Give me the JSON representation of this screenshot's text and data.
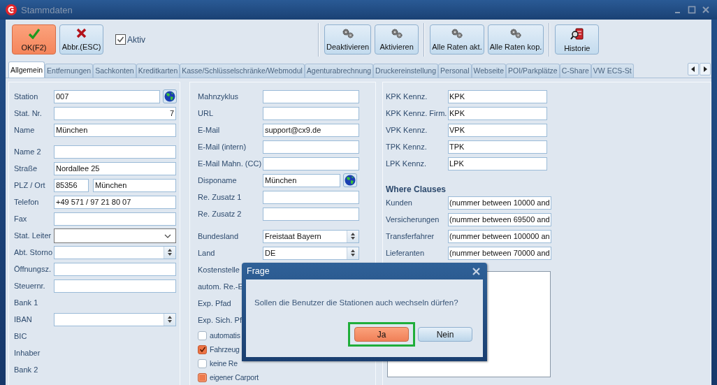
{
  "window": {
    "title": "Stammdaten"
  },
  "toolbar": {
    "groups": [
      [
        {
          "kind": "button",
          "label": "OK(F2)",
          "primary": true
        },
        {
          "kind": "button",
          "label": "Abbr.(ESC)",
          "primary": false
        },
        {
          "kind": "checkbox",
          "label": "Aktiv",
          "checked": true
        }
      ],
      [
        {
          "kind": "button",
          "label": "Deaktivieren",
          "primary": false
        },
        {
          "kind": "button",
          "label": "Aktivieren",
          "primary": false
        }
      ],
      [
        {
          "kind": "button",
          "label": "Alle Raten akt.",
          "primary": false
        },
        {
          "kind": "button",
          "label": "Alle Raten kop.",
          "primary": false
        }
      ],
      [
        {
          "kind": "button",
          "label": "Historie",
          "primary": false
        }
      ]
    ]
  },
  "tabs": [
    {
      "label": "Allgemein",
      "selected": true
    },
    {
      "label": "Entfernungen",
      "selected": false
    },
    {
      "label": "Sachkonten",
      "selected": false
    },
    {
      "label": "Kreditkarten",
      "selected": false
    },
    {
      "label": "Kasse/Schlüsselschränke/Webmodul",
      "selected": false
    },
    {
      "label": "Agenturabrechnung",
      "selected": false
    },
    {
      "label": "Druckereinstellung",
      "selected": false
    },
    {
      "label": "Personal",
      "selected": false
    },
    {
      "label": "Webseite",
      "selected": false
    },
    {
      "label": "POI/Parkplätze",
      "selected": false
    },
    {
      "label": "C-Share",
      "selected": false
    },
    {
      "label": "VW ECS-St",
      "selected": false
    }
  ],
  "left_panel": {
    "sections": [
      [
        {
          "kind": "text",
          "label": "Station",
          "value": "007",
          "globe": true
        },
        {
          "kind": "number",
          "label": "Stat. Nr.",
          "value": "7"
        },
        {
          "kind": "text",
          "label": "Name",
          "value": "München"
        }
      ],
      [
        {
          "kind": "text",
          "label": "Name 2"
        },
        {
          "kind": "text",
          "label": "Straße",
          "value": "Nordallee 25"
        },
        {
          "kind": "pair",
          "label": "PLZ / Ort",
          "values": [
            "85356",
            "München"
          ]
        },
        {
          "kind": "text",
          "label": "Telefon",
          "value": "+49 571 / 97 21 80 07"
        },
        {
          "kind": "text",
          "label": "Fax"
        },
        {
          "kind": "dropdown",
          "label": "Stat. Leiter"
        },
        {
          "kind": "spin",
          "label": "Abt. Storno"
        },
        {
          "kind": "text",
          "label": "Öffnungsz."
        },
        {
          "kind": "text",
          "label": "Steuernr."
        },
        {
          "kind": "label",
          "label": "Bank 1"
        },
        {
          "kind": "spin",
          "label": "IBAN"
        },
        {
          "kind": "label",
          "label": "BIC"
        },
        {
          "kind": "label",
          "label": "Inhaber"
        },
        {
          "kind": "label",
          "label": "Bank 2"
        }
      ]
    ]
  },
  "middle_panel": {
    "sections": [
      [
        {
          "kind": "text",
          "label": "Mahnzyklus"
        },
        {
          "kind": "text",
          "label": "URL"
        },
        {
          "kind": "text",
          "label": "E-Mail",
          "value": "support@cx9.de"
        },
        {
          "kind": "text",
          "label": "E-Mail (intern)"
        },
        {
          "kind": "text",
          "label": "E-Mail Mahn. (CC)"
        },
        {
          "kind": "text",
          "label": "Disponame",
          "value": "München",
          "globe": true
        },
        {
          "kind": "text",
          "label": "Re. Zusatz 1"
        },
        {
          "kind": "text",
          "label": "Re. Zusatz 2"
        }
      ],
      [
        {
          "kind": "spin",
          "label": "Bundesland",
          "value": "Freistaat Bayern"
        },
        {
          "kind": "spin",
          "label": "Land",
          "value": "DE"
        },
        {
          "kind": "label",
          "label": "Kostenstelle"
        },
        {
          "kind": "label",
          "label": "autom. Re.-E"
        },
        {
          "kind": "label",
          "label": "Exp. Pfad"
        },
        {
          "kind": "label",
          "label": "Exp. Sich. Pf"
        },
        {
          "kind": "checkbox",
          "label": "automatis",
          "checked": false,
          "indeterminate": false
        },
        {
          "kind": "checkbox",
          "label": "Fahrzeug",
          "checked": true,
          "indeterminate": false
        },
        {
          "kind": "checkbox",
          "label": "keine Re",
          "checked": false,
          "indeterminate": false
        },
        {
          "kind": "checkbox",
          "label": "eigener Carport",
          "checked": false,
          "indeterminate": true
        }
      ]
    ]
  },
  "right_panel": {
    "sections": [
      [
        {
          "kind": "text",
          "label": "KPK Kennz.",
          "value": "KPK"
        },
        {
          "kind": "text",
          "label": "KPK Kennz. Firm.",
          "value": "KPK"
        },
        {
          "kind": "text",
          "label": "VPK Kennz.",
          "value": "VPK"
        },
        {
          "kind": "text",
          "label": "TPK Kennz.",
          "value": "TPK"
        },
        {
          "kind": "text",
          "label": "LPK Kennz.",
          "value": "LPK"
        }
      ],
      [
        {
          "kind": "heading",
          "label": "Where Clauses"
        },
        {
          "kind": "text",
          "label": "Kunden",
          "value": "(nummer between 10000 and"
        },
        {
          "kind": "text",
          "label": "Versicherungen",
          "value": "(nummer between 69500 and"
        },
        {
          "kind": "text",
          "label": "Transferfahrer",
          "value": "(nummer between 100000 an"
        },
        {
          "kind": "text",
          "label": "Lieferanten",
          "value": "(nummer between 70000 and"
        },
        {
          "kind": "memo"
        }
      ]
    ]
  },
  "dialog": {
    "title": "Frage",
    "message": "Sollen die Benutzer die Stationen auch wechseln dürfen?",
    "buttons": [
      {
        "label": "Ja",
        "primary": true,
        "highlighted": true
      },
      {
        "label": "Nein",
        "primary": false,
        "highlighted": false
      }
    ]
  }
}
